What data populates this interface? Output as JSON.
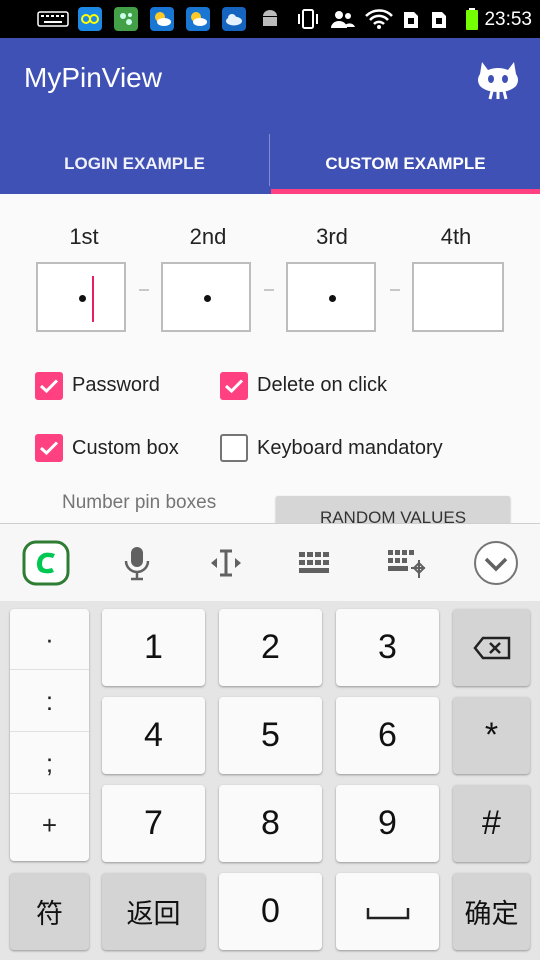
{
  "status_bar": {
    "time": "23:53",
    "icons": [
      "keyboard-icon",
      "app-icon-1",
      "app-icon-2",
      "weather-icon-1",
      "weather-icon-2",
      "cloud-icon",
      "android-icon",
      "vibrate-icon",
      "contacts-icon",
      "wifi-icon",
      "sim1-icon",
      "sim2-icon",
      "battery-icon"
    ]
  },
  "app_bar": {
    "title": "MyPinView",
    "logo_icon": "github-octocat-icon",
    "color": "#3f51b5"
  },
  "tabs": [
    {
      "label": "LOGIN EXAMPLE",
      "selected": false
    },
    {
      "label": "CUSTOM EXAMPLE",
      "selected": true
    }
  ],
  "accent_color": "#ff4081",
  "pin_view": {
    "labels": [
      "1st",
      "2nd",
      "3rd",
      "4th"
    ],
    "boxes": [
      {
        "filled": true,
        "focused": true
      },
      {
        "filled": true,
        "focused": false
      },
      {
        "filled": true,
        "focused": false
      },
      {
        "filled": false,
        "focused": false
      }
    ],
    "separator": "-"
  },
  "options": [
    {
      "label": "Password",
      "checked": true
    },
    {
      "label": "Delete on click",
      "checked": true
    },
    {
      "label": "Custom box",
      "checked": true
    },
    {
      "label": "Keyboard mandatory",
      "checked": false
    }
  ],
  "number_pin_boxes_label": "Number pin boxes",
  "random_values_button": "RANDOM VALUES",
  "keyboard_toolbar": {
    "icons": [
      "keyboard-logo-icon",
      "microphone-icon",
      "text-cursor-icon",
      "keyboard-layout-icon",
      "keyboard-settings-icon",
      "collapse-chevron-icon"
    ]
  },
  "keyboard": {
    "symbols": [
      "·",
      ":",
      ";",
      "+"
    ],
    "digits": [
      "1",
      "2",
      "3",
      "4",
      "5",
      "6",
      "7",
      "8",
      "9",
      "0"
    ],
    "backspace_icon": "backspace-icon",
    "star": "*",
    "hash": "#",
    "symbols_key": "符",
    "back_key": "返回",
    "space_icon": "space-icon",
    "confirm_key": "确定"
  }
}
